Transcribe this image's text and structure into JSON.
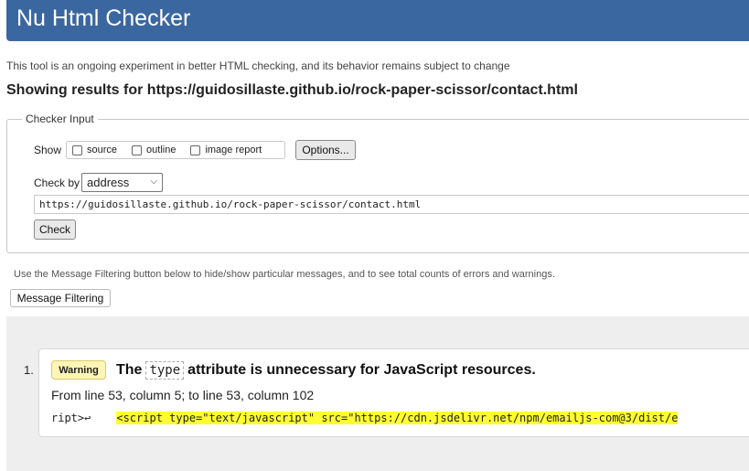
{
  "header": {
    "title": "Nu Html Checker"
  },
  "intro": "This tool is an ongoing experiment in better HTML checking, and its behavior remains subject to change",
  "results_heading": "Showing results for https://guidosillaste.github.io/rock-paper-scissor/contact.html",
  "checker_input": {
    "legend": "Checker Input",
    "show_label": "Show",
    "options": [
      {
        "label": "source",
        "checked": false
      },
      {
        "label": "outline",
        "checked": false
      },
      {
        "label": "image report",
        "checked": false
      }
    ],
    "options_button": "Options...",
    "check_by_label": "Check by",
    "check_by_value": "address",
    "url_value": "https://guidosillaste.github.io/rock-paper-scissor/contact.html",
    "check_button": "Check"
  },
  "filter": {
    "note": "Use the Message Filtering button below to hide/show particular messages, and to see total counts of errors and warnings.",
    "button": "Message Filtering"
  },
  "messages": [
    {
      "number": "1.",
      "badge": "Warning",
      "text_before": "The",
      "code": "type",
      "text_after": "attribute is unnecessary for JavaScript resources.",
      "location": "From line 53, column 5; to line 53, column 102",
      "extract_prefix": "ript>",
      "extract_newline": "↩",
      "extract_highlight": "<script type=\"text/javascript\" src=\"https://cdn.jsdelivr.net/npm/emailjs-com@3/dist/e"
    }
  ]
}
